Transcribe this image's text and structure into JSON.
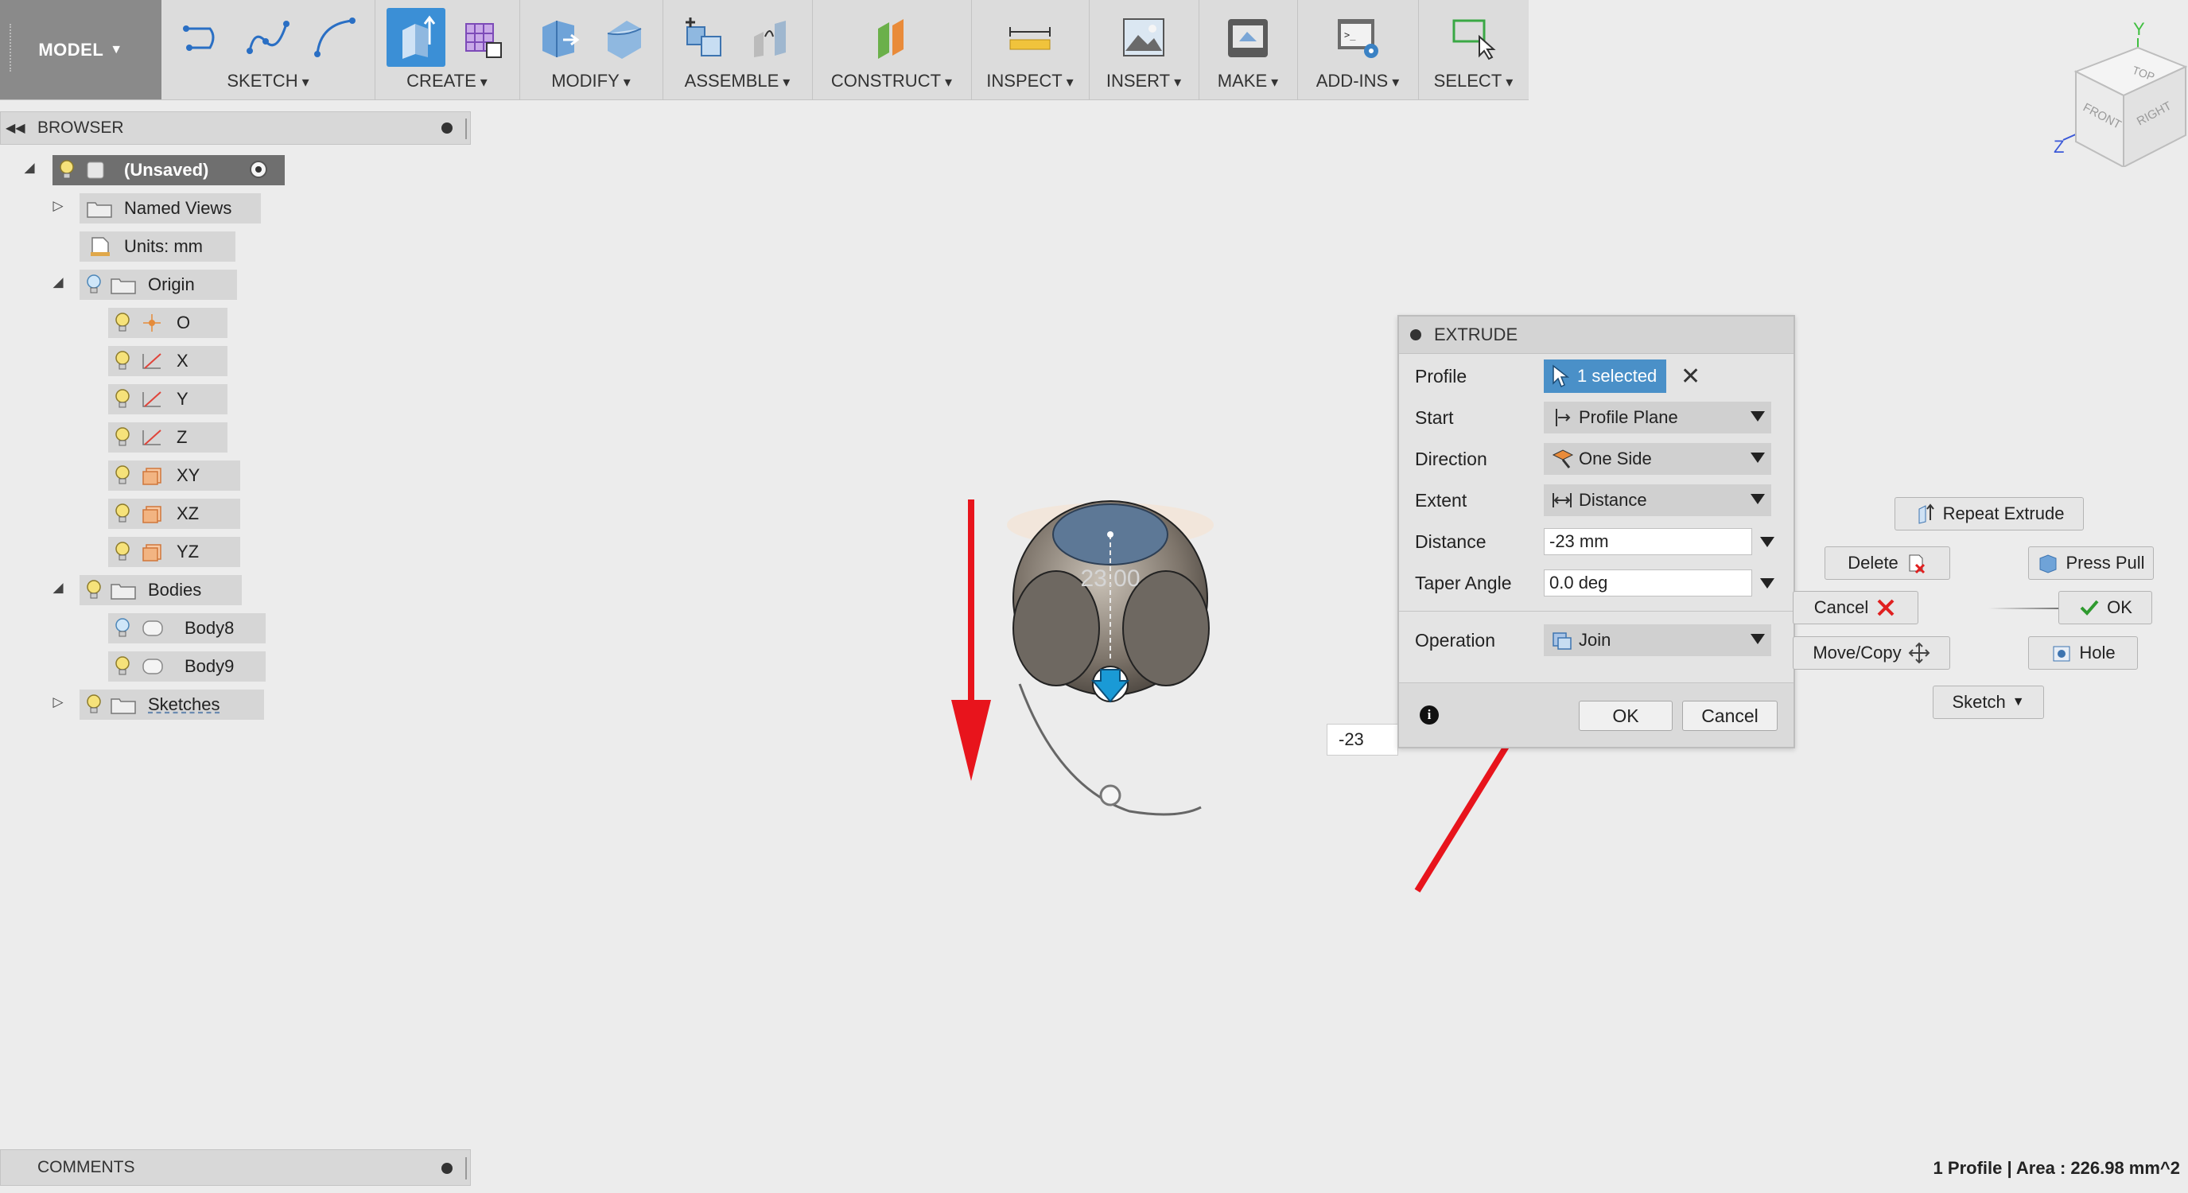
{
  "toolbar": {
    "model_label": "MODEL",
    "groups": {
      "sketch": "SKETCH",
      "create": "CREATE",
      "modify": "MODIFY",
      "assemble": "ASSEMBLE",
      "construct": "CONSTRUCT",
      "inspect": "INSPECT",
      "insert": "INSERT",
      "make": "MAKE",
      "addins": "ADD-INS",
      "select": "SELECT"
    }
  },
  "browser": {
    "title": "BROWSER",
    "root": "(Unsaved)",
    "named_views": "Named Views",
    "units": "Units: mm",
    "origin": "Origin",
    "origin_items": [
      "O",
      "X",
      "Y",
      "Z",
      "XY",
      "XZ",
      "YZ"
    ],
    "bodies": "Bodies",
    "body_items": [
      "Body8",
      "Body9"
    ],
    "sketches": "Sketches"
  },
  "comments": {
    "title": "COMMENTS"
  },
  "status": {
    "text": "1 Profile | Area : 226.98 mm^2"
  },
  "viewcube": {
    "top": "TOP",
    "front": "FRONT",
    "right": "RIGHT",
    "axis_y": "Y",
    "axis_z": "Z"
  },
  "viewport": {
    "dimension_label": "23.00",
    "distance_box": "-23"
  },
  "extrude": {
    "title": "EXTRUDE",
    "profile_label": "Profile",
    "profile_value": "1 selected",
    "start_label": "Start",
    "start_value": "Profile Plane",
    "direction_label": "Direction",
    "direction_value": "One Side",
    "extent_label": "Extent",
    "extent_value": "Distance",
    "distance_label": "Distance",
    "distance_value": "-23 mm",
    "taper_label": "Taper Angle",
    "taper_value": "0.0 deg",
    "operation_label": "Operation",
    "operation_value": "Join",
    "ok": "OK",
    "cancel": "Cancel"
  },
  "marking_menu": {
    "repeat": "Repeat Extrude",
    "delete": "Delete",
    "press_pull": "Press Pull",
    "cancel": "Cancel",
    "ok": "OK",
    "move_copy": "Move/Copy",
    "hole": "Hole",
    "sketch": "Sketch"
  },
  "colors": {
    "accent_blue": "#3b8fd6",
    "annotation_red": "#e8141c",
    "ok_green": "#2f9a2f"
  }
}
